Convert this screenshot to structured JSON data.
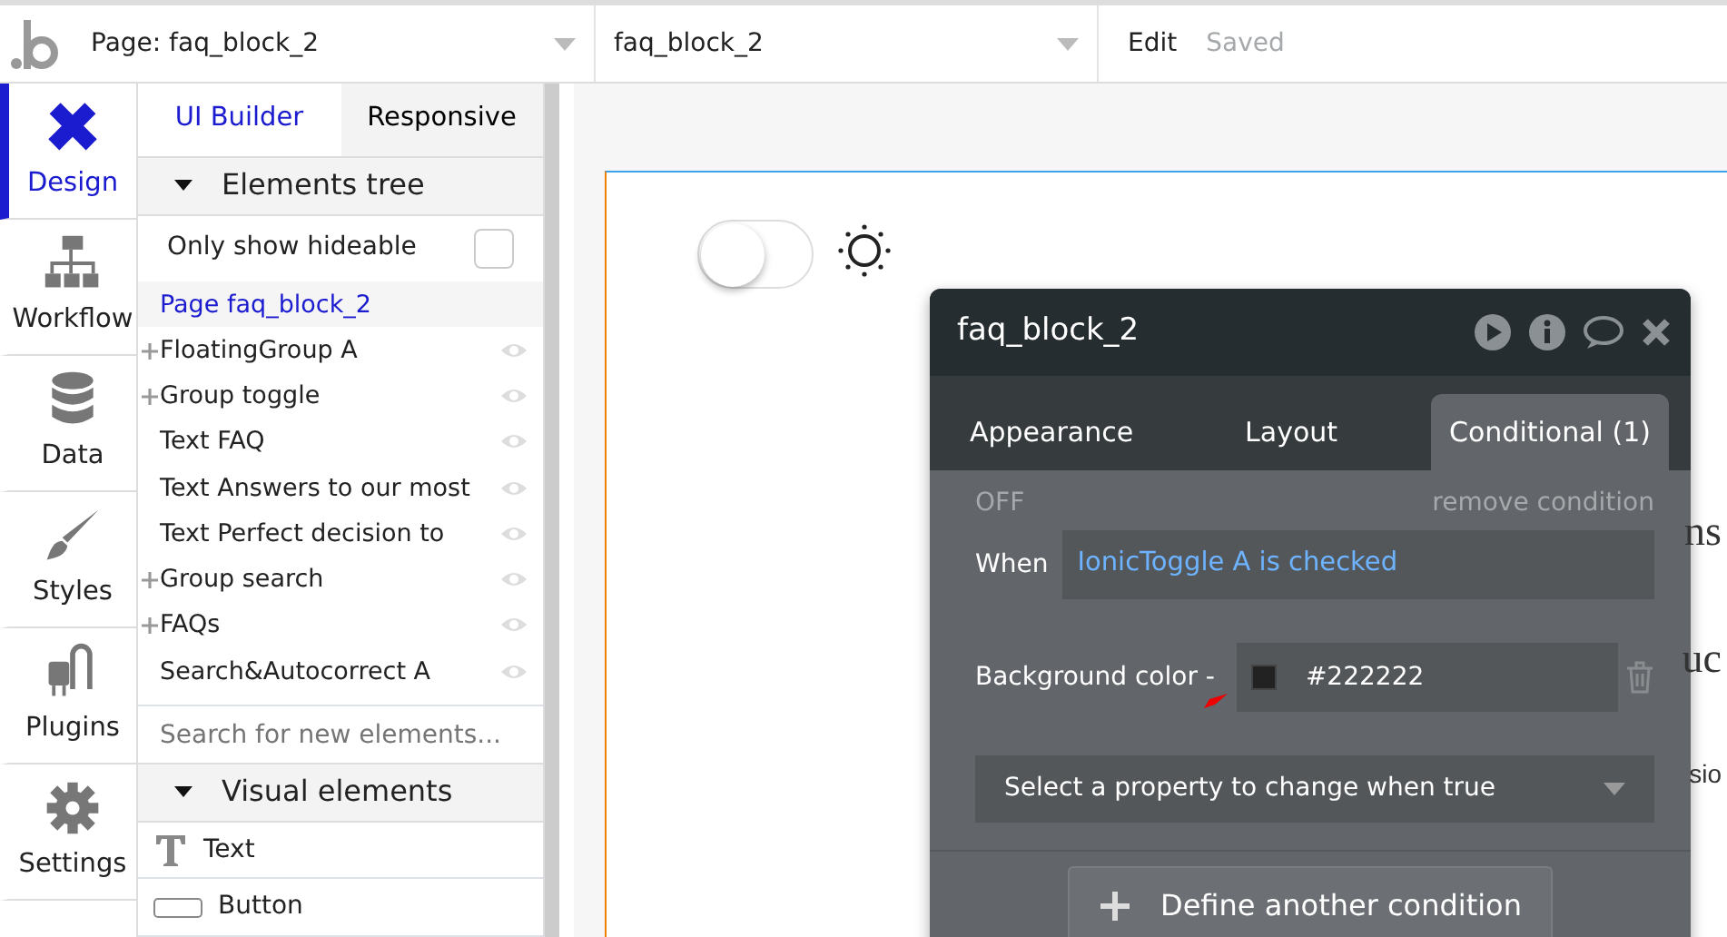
{
  "topbar": {
    "page_selector": "Page: faq_block_2",
    "element_selector": "faq_block_2",
    "edit_menu": "Edit",
    "save_status": "Saved"
  },
  "nav": [
    {
      "label": "Design",
      "selected": true
    },
    {
      "label": "Workflow",
      "selected": false
    },
    {
      "label": "Data",
      "selected": false
    },
    {
      "label": "Styles",
      "selected": false
    },
    {
      "label": "Plugins",
      "selected": false
    },
    {
      "label": "Settings",
      "selected": false
    }
  ],
  "panel": {
    "tabs": [
      {
        "label": "UI Builder",
        "selected": true
      },
      {
        "label": "Responsive",
        "selected": false
      }
    ],
    "tree_header": "Elements tree",
    "only_hideable": {
      "label": "Only show hideable",
      "checked": false
    },
    "tree": [
      {
        "label": "Page faq_block_2",
        "kind": "page",
        "expandable": false
      },
      {
        "label": "FloatingGroup A",
        "kind": "element",
        "expandable": true
      },
      {
        "label": "Group toggle",
        "kind": "element",
        "expandable": true
      },
      {
        "label": "Text FAQ",
        "kind": "element",
        "expandable": false
      },
      {
        "label": "Text Answers to our most",
        "kind": "element",
        "expandable": false
      },
      {
        "label": "Text Perfect decision to",
        "kind": "element",
        "expandable": false
      },
      {
        "label": "Group search",
        "kind": "element",
        "expandable": true
      },
      {
        "label": "FAQs",
        "kind": "element",
        "expandable": true
      },
      {
        "label": "Search&Autocorrect A",
        "kind": "element",
        "expandable": false
      }
    ],
    "search": {
      "placeholder": "Search for new elements..."
    },
    "visual_header": "Visual elements",
    "palette": [
      {
        "label": "Text"
      },
      {
        "label": "Button"
      }
    ]
  },
  "canvas": {
    "toggle": {
      "checked": false
    },
    "fragments": [
      "ns",
      "uc",
      "sio"
    ]
  },
  "dialog": {
    "title": "faq_block_2",
    "tabs": [
      {
        "label": "Appearance",
        "selected": false
      },
      {
        "label": "Layout",
        "selected": false
      },
      {
        "label": "Conditional (1)",
        "selected": true
      }
    ],
    "condition": {
      "status": "OFF",
      "remove": "remove condition",
      "when_label": "When",
      "expression": "IonicToggle A is checked",
      "property_label": "Background color -",
      "color": "#222222",
      "color_value": "#222222",
      "select_placeholder": "Select a property to change when true"
    },
    "add_button": "Define another condition"
  }
}
